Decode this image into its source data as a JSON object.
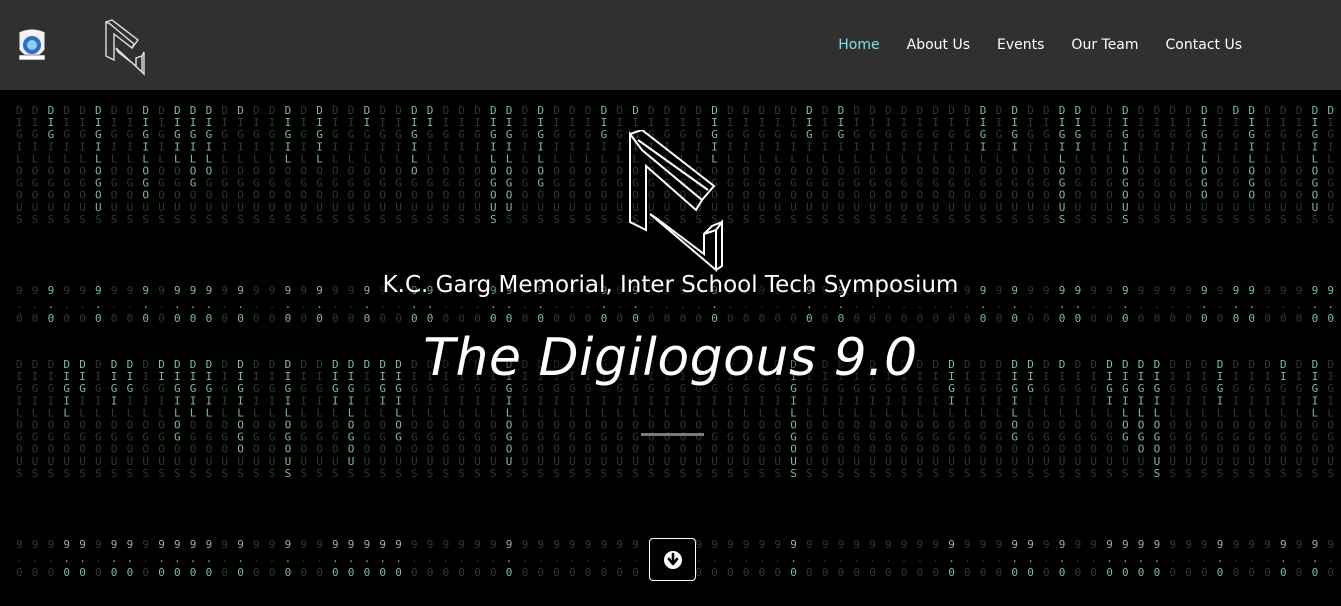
{
  "nav": {
    "items": [
      {
        "label": "Home",
        "active": true
      },
      {
        "label": "About Us",
        "active": false
      },
      {
        "label": "Events",
        "active": false
      },
      {
        "label": "Our Team",
        "active": false
      },
      {
        "label": "Contact Us",
        "active": false
      }
    ]
  },
  "hero": {
    "subtitle": "K.C. Garg Memorial, Inter School Tech Symposium",
    "title": "The Digilogous 9.0"
  },
  "background": {
    "text_sequence": "DIGILOGOUS",
    "version": "9.0",
    "colors": {
      "dim": "#2a3a38",
      "bright": "#7fb8aa"
    }
  },
  "icons": {
    "school_logo": "school-emblem-icon",
    "brand_logo": "digilogous-logo-icon",
    "scroll": "arrow-down-circle-icon"
  },
  "colors": {
    "navbar_bg": "#303030",
    "active_link": "#7fe0e0",
    "hero_bg": "#000000"
  }
}
